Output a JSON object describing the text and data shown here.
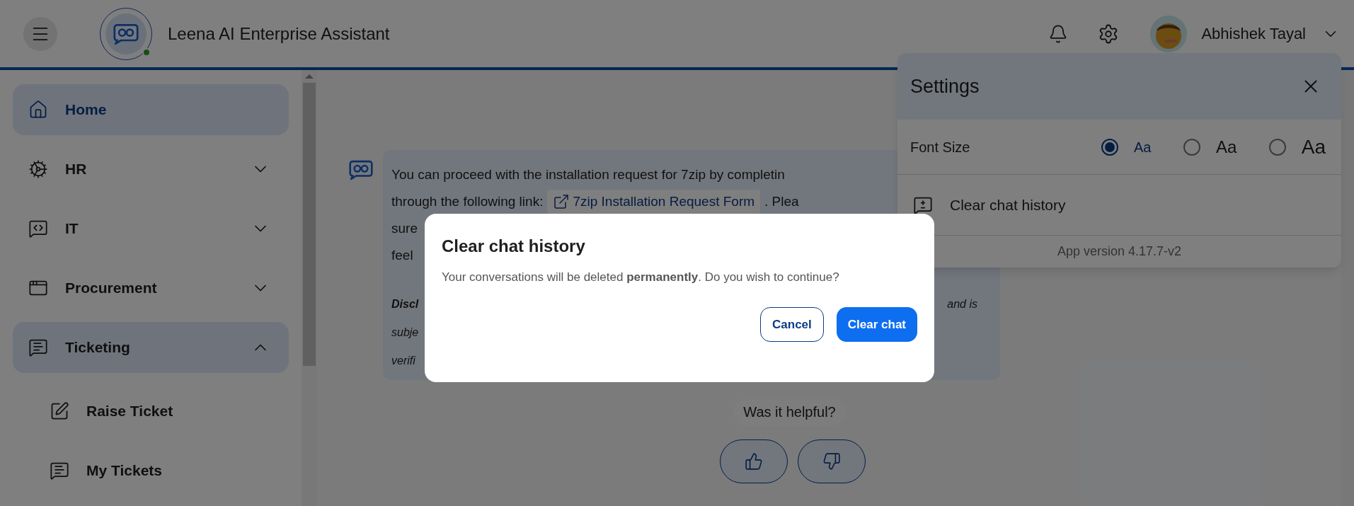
{
  "header": {
    "title": "Leena AI Enterprise Assistant",
    "user_name": "Abhishek Tayal",
    "online": true
  },
  "sidebar": {
    "items": [
      {
        "label": "Home",
        "selected": true
      },
      {
        "label": "HR",
        "selected": false,
        "expanded": false
      },
      {
        "label": "IT",
        "selected": false,
        "expanded": false
      },
      {
        "label": "Procurement",
        "selected": false,
        "expanded": false
      },
      {
        "label": "Ticketing",
        "selected": false,
        "expanded": true,
        "children": [
          {
            "label": "Raise Ticket"
          },
          {
            "label": "My Tickets"
          }
        ]
      }
    ]
  },
  "message": {
    "lines": [
      {
        "segments": [
          {
            "kind": "text",
            "text": "You can proceed with the installation request for 7zip by completin"
          }
        ]
      },
      {
        "segments": [
          {
            "kind": "text",
            "text": "through the following link:"
          },
          {
            "kind": "link",
            "text": "7zip Installation Request Form"
          },
          {
            "kind": "text",
            "text": ". Plea"
          }
        ]
      },
      {
        "segments": [
          {
            "kind": "text",
            "text": "sure"
          }
        ]
      },
      {
        "segments": [
          {
            "kind": "text",
            "text": "feel"
          }
        ]
      }
    ],
    "disclaimer": [
      {
        "left": "Discl",
        "right": "and is"
      },
      {
        "left": "subje"
      },
      {
        "left": "verifi"
      }
    ]
  },
  "feedback": {
    "question": "Was it helpful?"
  },
  "settings": {
    "title": "Settings",
    "font_size_label": "Font Size",
    "font_sizes": [
      {
        "label": "Aa",
        "selected": true
      },
      {
        "label": "Aa",
        "selected": false
      },
      {
        "label": "Aa",
        "selected": false
      }
    ],
    "clear_label": "Clear chat history",
    "version": "App version 4.17.7-v2"
  },
  "dialog": {
    "title": "Clear chat history",
    "text": "Your conversations will be deleted **permanently**. Do you wish to continue?",
    "buttons": [
      {
        "label": "Cancel",
        "kind": "secondary"
      },
      {
        "label": "Clear chat",
        "kind": "primary"
      }
    ]
  }
}
